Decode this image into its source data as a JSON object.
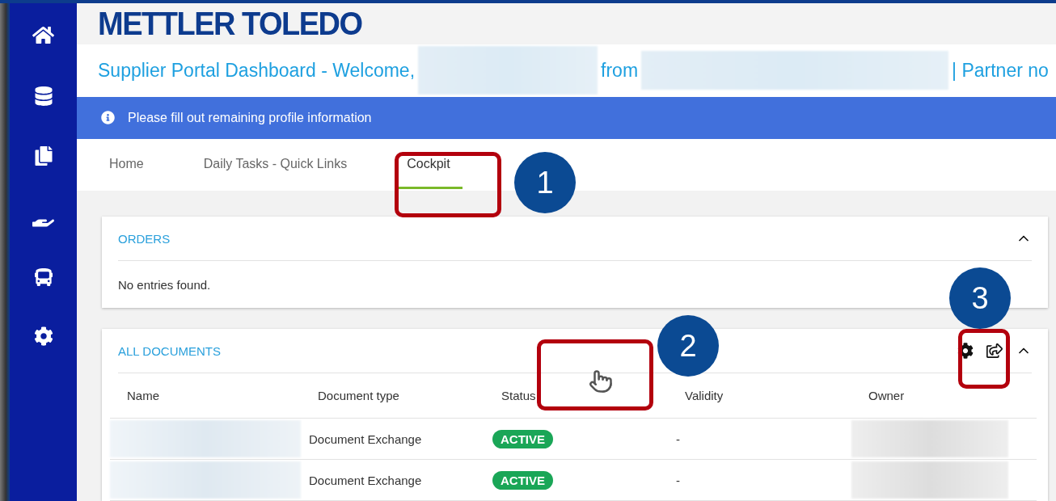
{
  "logo": "METTLER TOLEDO",
  "welcome": [
    {
      "kind": "text",
      "text": "Supplier Portal Dashboard - Welcome,"
    },
    {
      "kind": "redacted"
    },
    {
      "kind": "text",
      "text": "from"
    },
    {
      "kind": "redacted"
    },
    {
      "kind": "text",
      "text": "| Partner no"
    }
  ],
  "banner": {
    "text": "Please fill out remaining profile information"
  },
  "tabs": [
    {
      "label": "Home",
      "selected": false
    },
    {
      "label": "Daily Tasks - Quick Links",
      "selected": false
    },
    {
      "label": "Cockpit",
      "selected": true
    }
  ],
  "orders": {
    "title": "ORDERS",
    "expanded": true,
    "message": "No entries found."
  },
  "documents": {
    "title": "ALL DOCUMENTS",
    "expanded": true,
    "columns": [
      "Name",
      "Document type",
      "Status",
      "Validity",
      "Owner"
    ],
    "rows": [
      {
        "document_type": "Document Exchange",
        "status": "ACTIVE",
        "validity": "-"
      },
      {
        "document_type": "Document Exchange",
        "status": "ACTIVE",
        "validity": "-"
      }
    ]
  },
  "annotations": [
    {
      "number": "1"
    },
    {
      "number": "2"
    },
    {
      "number": "3"
    }
  ]
}
